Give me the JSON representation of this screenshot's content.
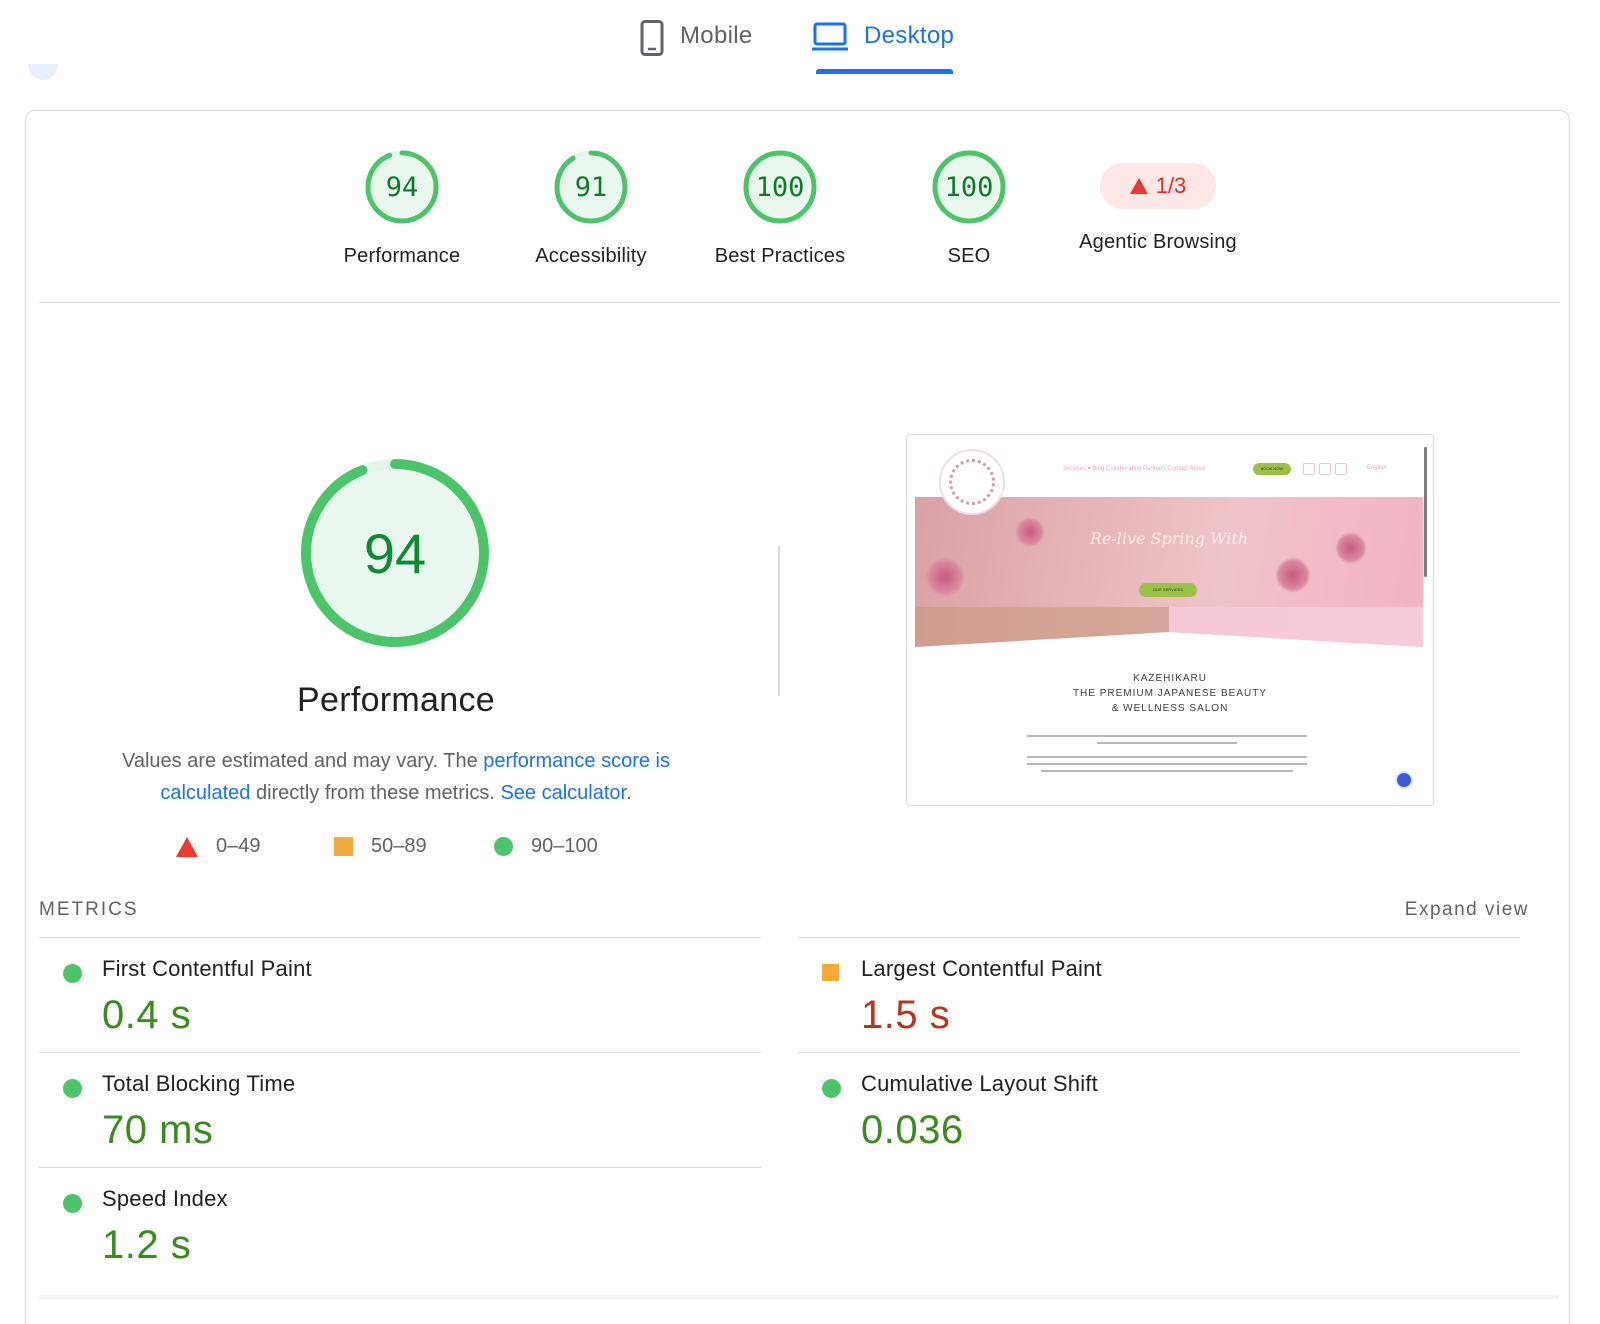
{
  "tabs": {
    "mobile_label": "Mobile",
    "desktop_label": "Desktop",
    "active": "Desktop"
  },
  "colors": {
    "pass": "#0cce6b",
    "average": "#ffa400",
    "fail": "#ff4e42",
    "link": "#1a73e8"
  },
  "categories": [
    {
      "label": "Performance",
      "score": "94",
      "score_value": 94
    },
    {
      "label": "Accessibility",
      "score": "91",
      "score_value": 91
    },
    {
      "label": "Best Practices",
      "score": "100",
      "score_value": 100
    },
    {
      "label": "SEO",
      "score": "100",
      "score_value": 100
    },
    {
      "label": "Agentic Browsing",
      "score": "1/3",
      "icon": "warning-triangle-icon"
    }
  ],
  "performance": {
    "score": "94",
    "score_value": 94,
    "title": "Performance",
    "desc_prefix": "Values are estimated and may vary. The ",
    "desc_link1": "performance score is calculated",
    "desc_middle": " directly from these metrics. ",
    "desc_link2": "See calculator",
    "desc_suffix": ".",
    "legend": [
      {
        "icon": "red-triangle-icon",
        "range": "0–49"
      },
      {
        "icon": "orange-square-icon",
        "range": "50–89"
      },
      {
        "icon": "green-circle-icon",
        "range": "90–100"
      }
    ]
  },
  "screenshot": {
    "nav_links": "Services ▾   Blog   Collaborating Partners   Contact   About",
    "book_now": "BOOK NOW",
    "language": "English",
    "hero_title": "Re-live Spring With",
    "hero_button": "OUR SERVICES",
    "heading_line1": "KAZEHIKARU",
    "heading_line2": "THE PREMIUM JAPANESE BEAUTY",
    "heading_line3": "& WELLNESS SALON"
  },
  "metrics": {
    "header": "METRICS",
    "expand_label": "Expand view",
    "items": [
      {
        "name": "First Contentful Paint",
        "value": "0.4 s",
        "status": "pass"
      },
      {
        "name": "Largest Contentful Paint",
        "value": "1.5 s",
        "status": "average"
      },
      {
        "name": "Total Blocking Time",
        "value": "70 ms",
        "status": "pass"
      },
      {
        "name": "Cumulative Layout Shift",
        "value": "0.036",
        "status": "pass"
      },
      {
        "name": "Speed Index",
        "value": "1.2 s",
        "status": "pass"
      }
    ]
  }
}
